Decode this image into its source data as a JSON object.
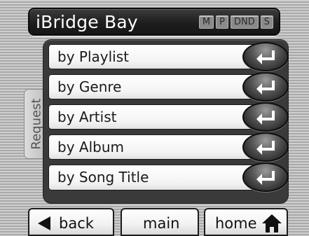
{
  "header": {
    "title": "iBridge Bay",
    "badges": [
      "M",
      "P",
      "DND",
      "S"
    ]
  },
  "side_tab": {
    "label": "Request"
  },
  "menu": {
    "items": [
      {
        "label": "by Playlist",
        "icon": "enter-return-icon"
      },
      {
        "label": "by Genre",
        "icon": "enter-return-icon"
      },
      {
        "label": "by Artist",
        "icon": "enter-return-icon"
      },
      {
        "label": "by Album",
        "icon": "enter-return-icon"
      },
      {
        "label": "by Song Title",
        "icon": "enter-return-icon"
      }
    ]
  },
  "nav": {
    "back_label": "back",
    "back_icon": "left-triangle-icon",
    "main_label": "main",
    "home_label": "home",
    "home_icon": "house-icon"
  },
  "colors": {
    "title_bar": "#1e1e1e",
    "title_text": "#ffffff",
    "badge": "#8a8a8a",
    "menu_panel": "#3a3a3a",
    "menu_item": "#ffffff",
    "enter_button": "#555555",
    "background_stripes": [
      "#cfcfcf",
      "#a9a9a9"
    ]
  }
}
